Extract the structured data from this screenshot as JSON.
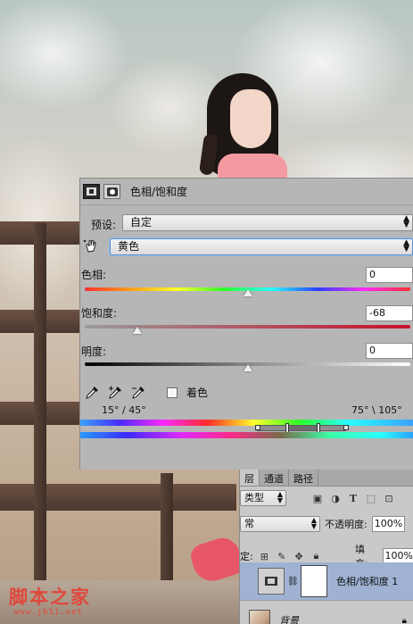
{
  "properties_panel": {
    "title": "色相/饱和度",
    "header_icons": [
      "adjustment-icon",
      "mask-icon"
    ],
    "preset": {
      "label": "预设:",
      "value": "自定"
    },
    "channel": {
      "value": "黄色"
    },
    "hue": {
      "label": "色相:",
      "value": "0"
    },
    "saturation": {
      "label": "饱和度:",
      "value": "-68"
    },
    "lightness": {
      "label": "明度:",
      "value": "0"
    },
    "colorize": {
      "label": "着色",
      "checked": false
    },
    "range_left": "15° / 45°",
    "range_right": "75° \\ 105°"
  },
  "layers_panel": {
    "tabs": [
      "层",
      "通道",
      "路径"
    ],
    "kind_filter": "类型",
    "filter_icons": [
      "image-filter-icon",
      "adjustment-filter-icon",
      "type-filter-icon",
      "shape-filter-icon",
      "smart-object-filter-icon"
    ],
    "blend_mode": "常",
    "opacity_label": "不透明度:",
    "opacity_value": "100%",
    "lock_label": "定:",
    "fill_label": "填充:",
    "fill_value": "100%",
    "layers": [
      {
        "name": "色相/饱和度 1",
        "selected": true
      },
      {
        "name": "背景",
        "selected": false
      }
    ]
  },
  "watermark": {
    "title": "脚本之家",
    "url": "www.jb51.net"
  },
  "colors": {
    "panel_bg": "#b6b6b6",
    "selected_layer": "#9fb2d3",
    "watermark": "#e0483c"
  }
}
